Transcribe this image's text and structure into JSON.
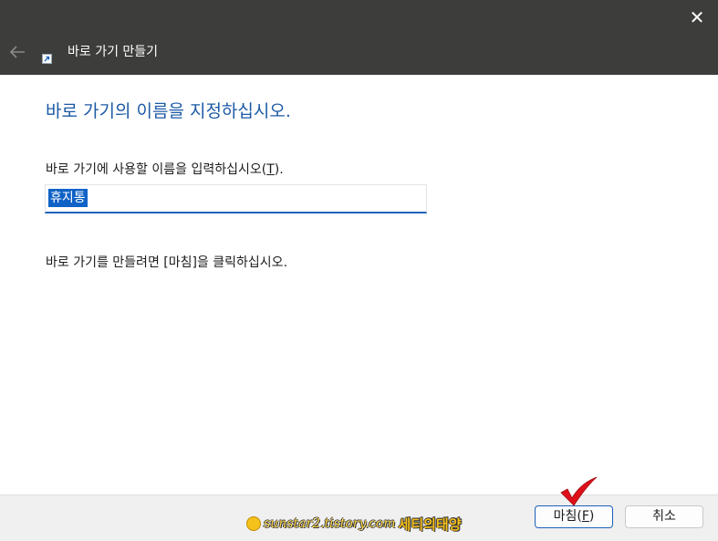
{
  "window": {
    "title": "바로 가기 만들기",
    "close_glyph": "✕"
  },
  "page": {
    "heading": "바로 가기의 이름을 지정하십시오.",
    "name_label_prefix": "바로 가기에 사용할 이름을 입력하십시오(",
    "name_label_key": "T",
    "name_label_suffix": ").",
    "name_value": "휴지통",
    "hint": "바로 가기를 만들려면 [마침]을 클릭하십시오."
  },
  "buttons": {
    "finish_prefix": "마침(",
    "finish_key": "F",
    "finish_suffix": ")",
    "cancel": "취소"
  },
  "watermark": {
    "url": "sunstar2.tistory.com",
    "name": "세티의태양"
  },
  "colors": {
    "titlebar": "#3d3d3b",
    "heading": "#1c5aa6",
    "accent": "#1d62b8",
    "selection": "#0f62c6",
    "checkmark": "#e0101a"
  },
  "icons": {
    "back": "back-arrow-icon",
    "close": "close-icon",
    "shortcut": "shortcut-arrow-icon",
    "checkmark": "red-checkmark-icon"
  }
}
